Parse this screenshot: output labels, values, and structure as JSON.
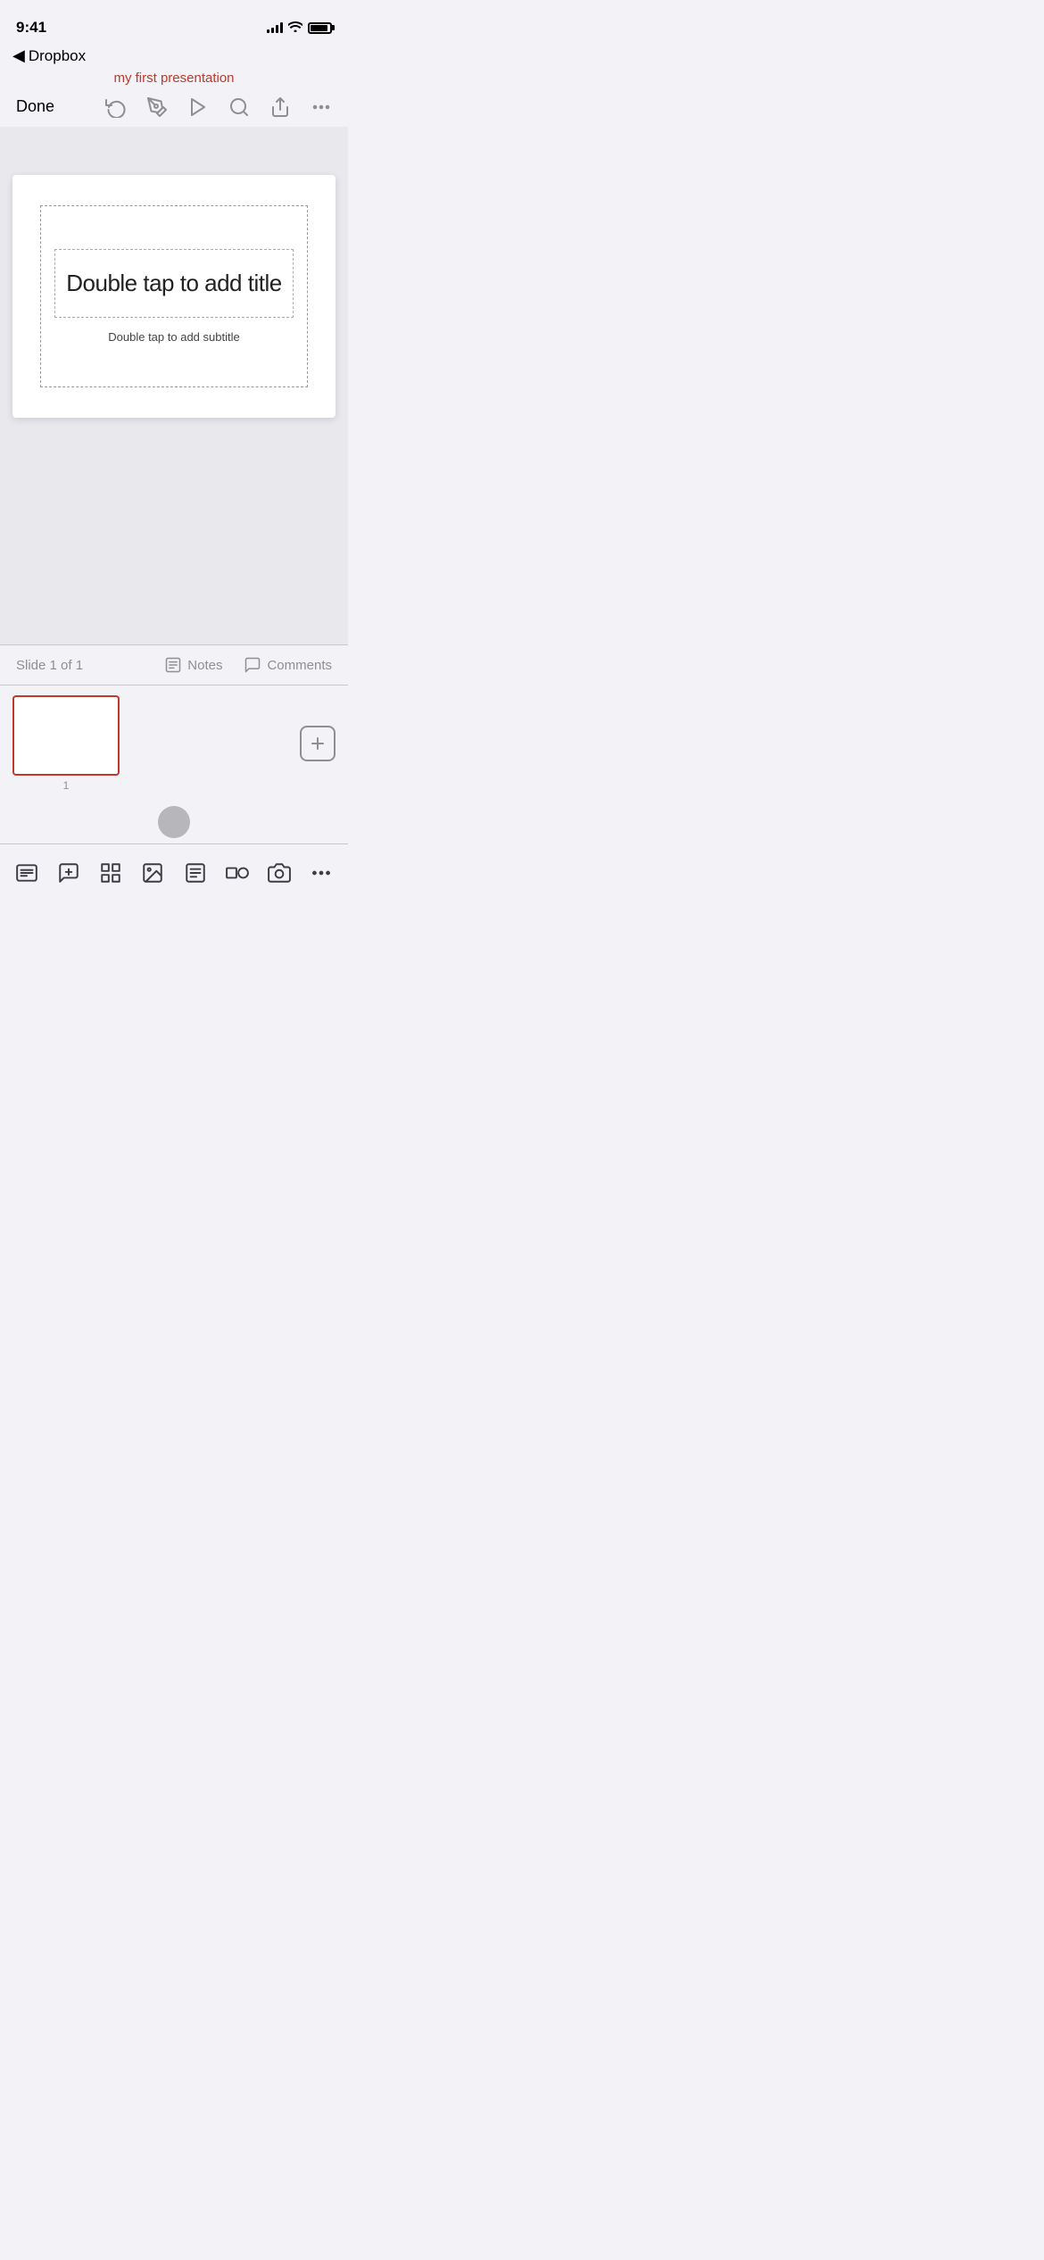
{
  "statusBar": {
    "time": "9:41",
    "backLabel": "Dropbox"
  },
  "header": {
    "presentationTitle": "my first presentation",
    "doneLabel": "Done"
  },
  "toolbar": {
    "icons": [
      "undo",
      "annotate",
      "play",
      "search",
      "share",
      "more"
    ]
  },
  "slide": {
    "titlePlaceholder": "Double tap to add title",
    "subtitlePlaceholder": "Double tap to add subtitle"
  },
  "slideMetaBar": {
    "slideCount": "Slide 1 of 1",
    "notesLabel": "Notes",
    "commentsLabel": "Comments"
  },
  "thumbnail": {
    "slideNumber": "1",
    "addLabel": "+"
  },
  "bottomToolbar": {
    "tools": [
      "slides",
      "add-comment",
      "grid-view",
      "insert-image",
      "format",
      "objects",
      "camera",
      "more"
    ]
  }
}
